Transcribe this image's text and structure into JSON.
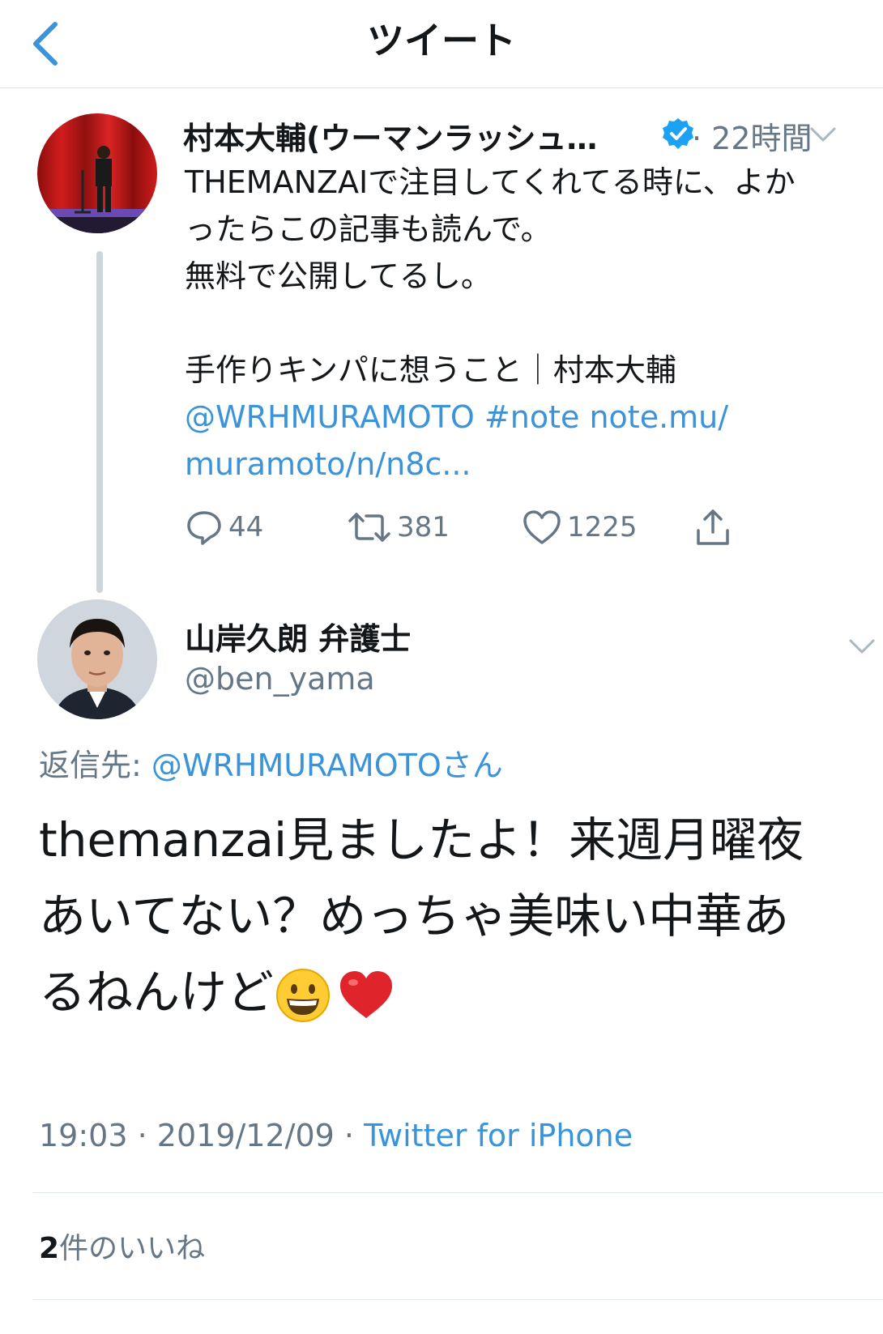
{
  "header": {
    "title": "ツイート"
  },
  "original_tweet": {
    "author_name": "村本大輔(ウーマンラッシュ…",
    "timestamp": "· 22時間",
    "lines": [
      "THEMANZAIで注目してくれてる時に、よか",
      "ったらこの記事も読んで。",
      "無料で公開してるし。",
      "",
      "手作りキンパに想うこと｜村本大輔"
    ],
    "link_mention": "@WRHMURAMOTO",
    "link_hashtag": "#note",
    "link_url_1": "note.mu/",
    "link_url_2": "muramoto/n/n8c...",
    "reply_count": "44",
    "retweet_count": "381",
    "like_count": "1225"
  },
  "reply_tweet": {
    "author_name": "山岸久朗 弁護士",
    "handle": "@ben_yama",
    "replying_label": "返信先:",
    "replying_to": "@WRHMURAMOTOさん",
    "lines": [
      "themanzai見ましたよ！来週月曜夜",
      "あいてない？めっちゃ美味い中華あ",
      "るねんけど"
    ],
    "time": "19:03",
    "date": "2019/12/09",
    "separator": "·",
    "source": "Twitter for iPhone",
    "likes_count": "2",
    "likes_label": "件のいいね"
  },
  "colors": {
    "link": "#3b94d9",
    "muted": "#657786",
    "text": "#14171a",
    "verified": "#1da1f2"
  },
  "icons": [
    "back-chevron-icon",
    "verified-badge-icon",
    "chevron-down-icon",
    "reply-icon",
    "retweet-icon",
    "like-icon",
    "share-icon",
    "grinning-emoji-icon",
    "heart-emoji-icon"
  ]
}
